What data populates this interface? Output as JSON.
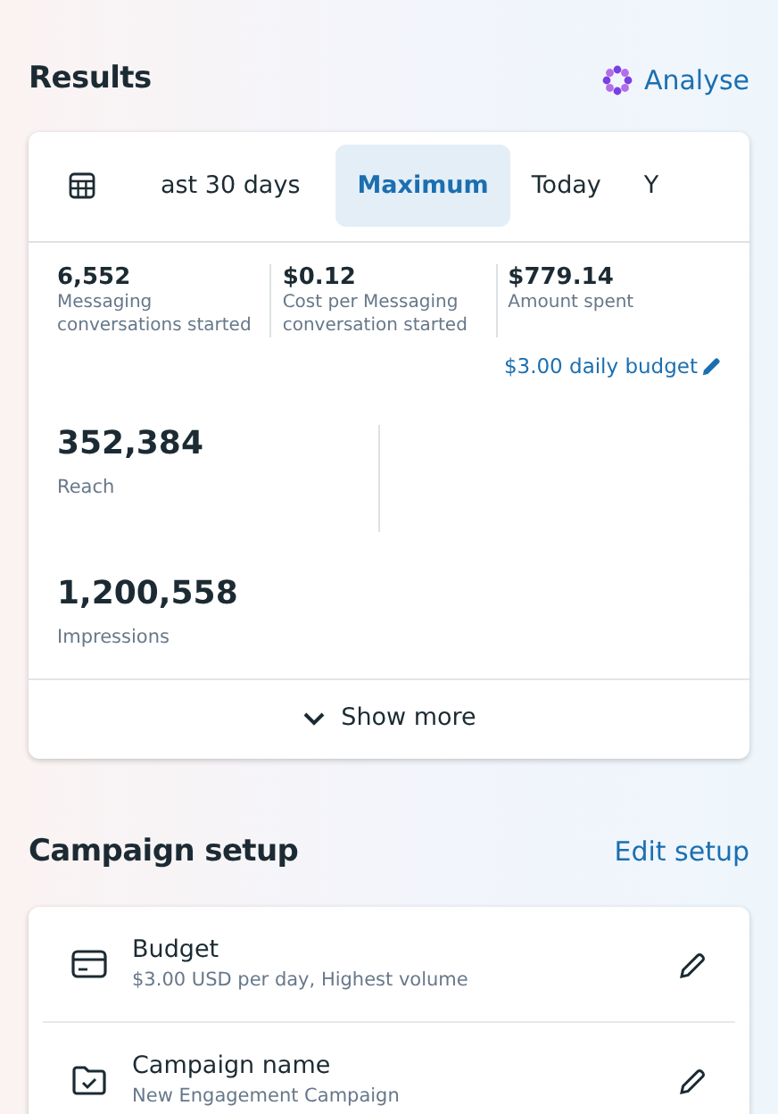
{
  "results": {
    "title": "Results",
    "action": "Analyse",
    "tabs": [
      {
        "label": "ast 30 days",
        "selected": false
      },
      {
        "label": "Maximum",
        "selected": true
      },
      {
        "label": "Today",
        "selected": false
      },
      {
        "label": "Y",
        "selected": false
      }
    ],
    "summary": [
      {
        "value": "6,552",
        "label": "Messaging conversations started"
      },
      {
        "value": "$0.12",
        "label": "Cost per Messaging conversation started"
      },
      {
        "value": "$779.14",
        "label": "Amount spent"
      }
    ],
    "budget_link": "$3.00 daily budget",
    "metrics": [
      {
        "value": "352,384",
        "label": "Reach"
      },
      {
        "value": "1,200,558",
        "label": "Impressions"
      }
    ],
    "show_more": "Show more"
  },
  "campaign_setup": {
    "title": "Campaign setup",
    "action": "Edit setup",
    "items": [
      {
        "kind": "budget",
        "title": "Budget",
        "subtitle": "$3.00 USD per day, Highest volume"
      },
      {
        "kind": "name",
        "title": "Campaign name",
        "subtitle": "New Engagement Campaign"
      }
    ]
  }
}
